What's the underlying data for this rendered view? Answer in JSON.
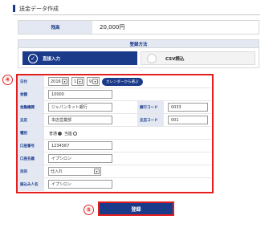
{
  "page": {
    "title": "送金データ作成"
  },
  "balance": {
    "label": "残高",
    "value": "20,000円"
  },
  "method": {
    "header": "登録方法",
    "options": [
      {
        "label": "直接入力",
        "selected": true
      },
      {
        "label": "CSV読込",
        "selected": false
      }
    ]
  },
  "callouts": {
    "form": "④",
    "submit": "⑤"
  },
  "form": {
    "date": {
      "label": "日付",
      "year": "2016",
      "month": "1",
      "day": "9",
      "calendar_button": "カレンダーから選ぶ"
    },
    "amount": {
      "label": "金額",
      "value": "10000"
    },
    "bank": {
      "label": "金融機関",
      "value": "ジャパンネット銀行",
      "code_label": "銀行コード",
      "code_value": "0033"
    },
    "branch": {
      "label": "支店",
      "value": "本店営業部",
      "code_label": "支店コード",
      "code_value": "001"
    },
    "account_type": {
      "label": "種別",
      "options": [
        "普通",
        "当座"
      ],
      "selected": "普通"
    },
    "account_number": {
      "label": "口座番号",
      "value": "1234567"
    },
    "account_name": {
      "label": "口座名義",
      "value": "イプシロン"
    },
    "purpose": {
      "label": "目的",
      "value": "仕入れ"
    },
    "remitter": {
      "label": "振込み人名",
      "value": "イプシロン"
    }
  },
  "submit": {
    "label": "登録"
  },
  "colors": {
    "accent": "#1a3a8a",
    "highlight": "#e41e1e",
    "label_bg": "#e3e8f2"
  }
}
